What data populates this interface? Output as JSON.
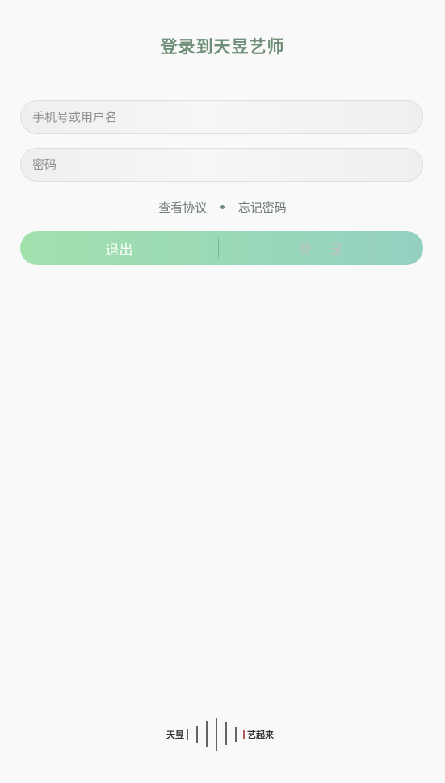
{
  "login": {
    "title": "登录到天昱艺师",
    "phone_placeholder": "手机号或用户名",
    "password_placeholder": "密码",
    "agreement_link": "查看协议",
    "forgot_link": "忘记密码",
    "exit_label": "退出",
    "login_label": "登 录"
  },
  "brand": {
    "left_text": "天昱",
    "right_text": "艺起来"
  }
}
